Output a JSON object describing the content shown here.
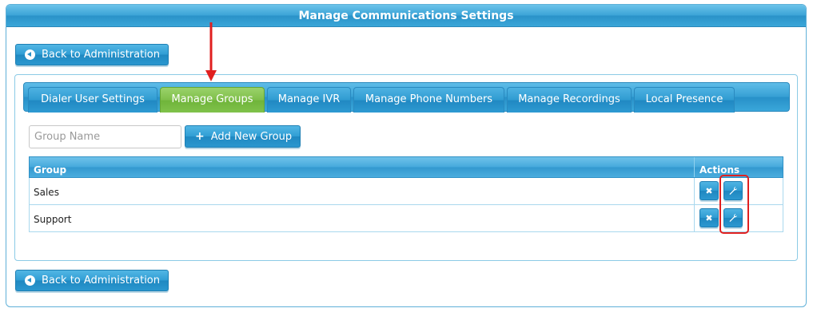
{
  "header": {
    "title": "Manage Communications Settings"
  },
  "back_button": {
    "label": "Back to Administration",
    "icon": "circle-arrow-left-icon"
  },
  "tabs": [
    {
      "label": "Dialer User Settings",
      "active": false
    },
    {
      "label": "Manage Groups",
      "active": true
    },
    {
      "label": "Manage IVR",
      "active": false
    },
    {
      "label": "Manage Phone Numbers",
      "active": false
    },
    {
      "label": "Manage Recordings",
      "active": false
    },
    {
      "label": "Local Presence",
      "active": false
    }
  ],
  "search": {
    "placeholder": "Group Name",
    "value": ""
  },
  "add_button": {
    "label": "Add New Group",
    "icon": "plus-icon"
  },
  "table": {
    "columns": [
      "Group",
      "Actions"
    ],
    "rows": [
      {
        "name": "Sales",
        "actions": [
          "delete-icon",
          "wrench-icon"
        ]
      },
      {
        "name": "Support",
        "actions": [
          "delete-icon",
          "wrench-icon"
        ]
      }
    ]
  },
  "colors": {
    "accent": "#2a92c8",
    "active_tab": "#7fbf4a",
    "annotation": "#e02020"
  }
}
